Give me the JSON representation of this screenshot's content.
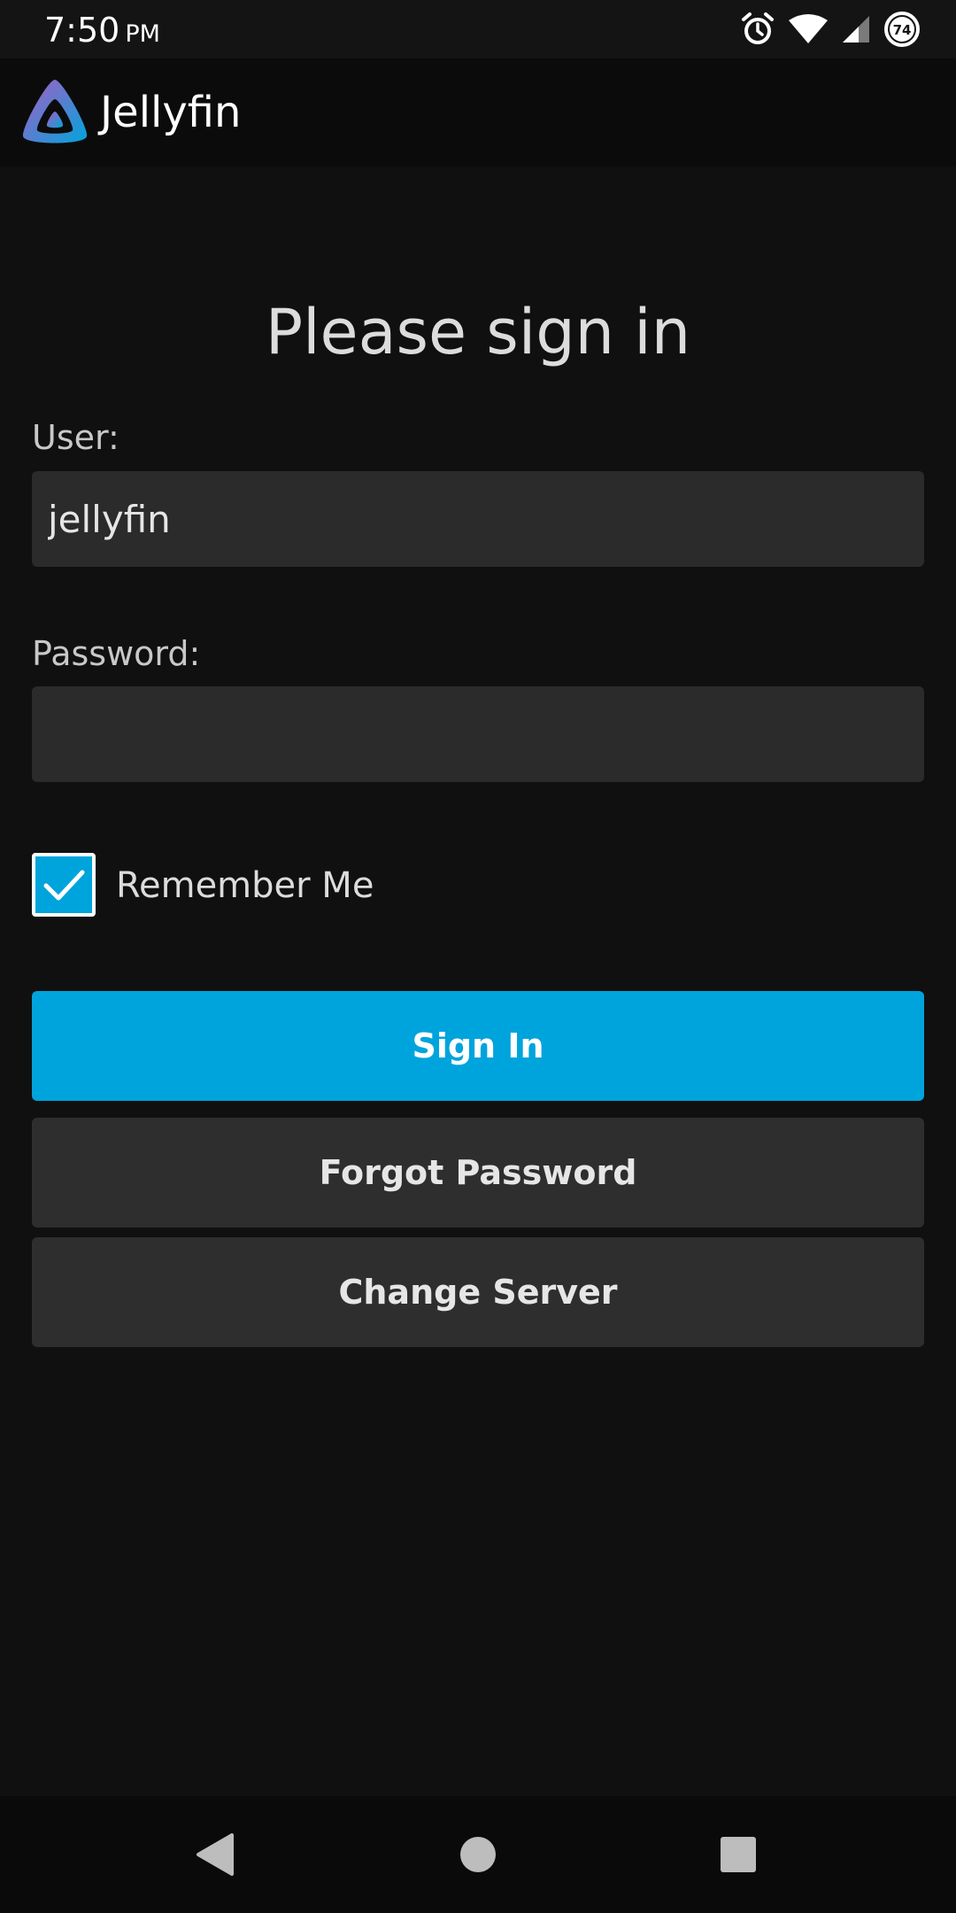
{
  "status_bar": {
    "time": "7:50",
    "ampm": "PM",
    "battery_level": "74",
    "icons": [
      "alarm-icon",
      "wifi-icon",
      "cell-signal-icon",
      "battery-icon"
    ]
  },
  "app_bar": {
    "title": "Jellyfin",
    "logo_icon": "jellyfin-logo-icon"
  },
  "login": {
    "heading": "Please sign in",
    "user_label": "User:",
    "user_value": "jellyfin",
    "password_label": "Password:",
    "password_value": "",
    "remember_me_label": "Remember Me",
    "remember_me_checked": true,
    "sign_in_label": "Sign In",
    "forgot_password_label": "Forgot Password",
    "change_server_label": "Change Server"
  },
  "nav_bar": {
    "icons": [
      "back-icon",
      "home-icon",
      "recents-icon"
    ]
  },
  "colors": {
    "accent": "#00a4dc",
    "background": "#101010",
    "field_background": "#2b2b2b",
    "secondary_button": "#2e2e2e"
  }
}
